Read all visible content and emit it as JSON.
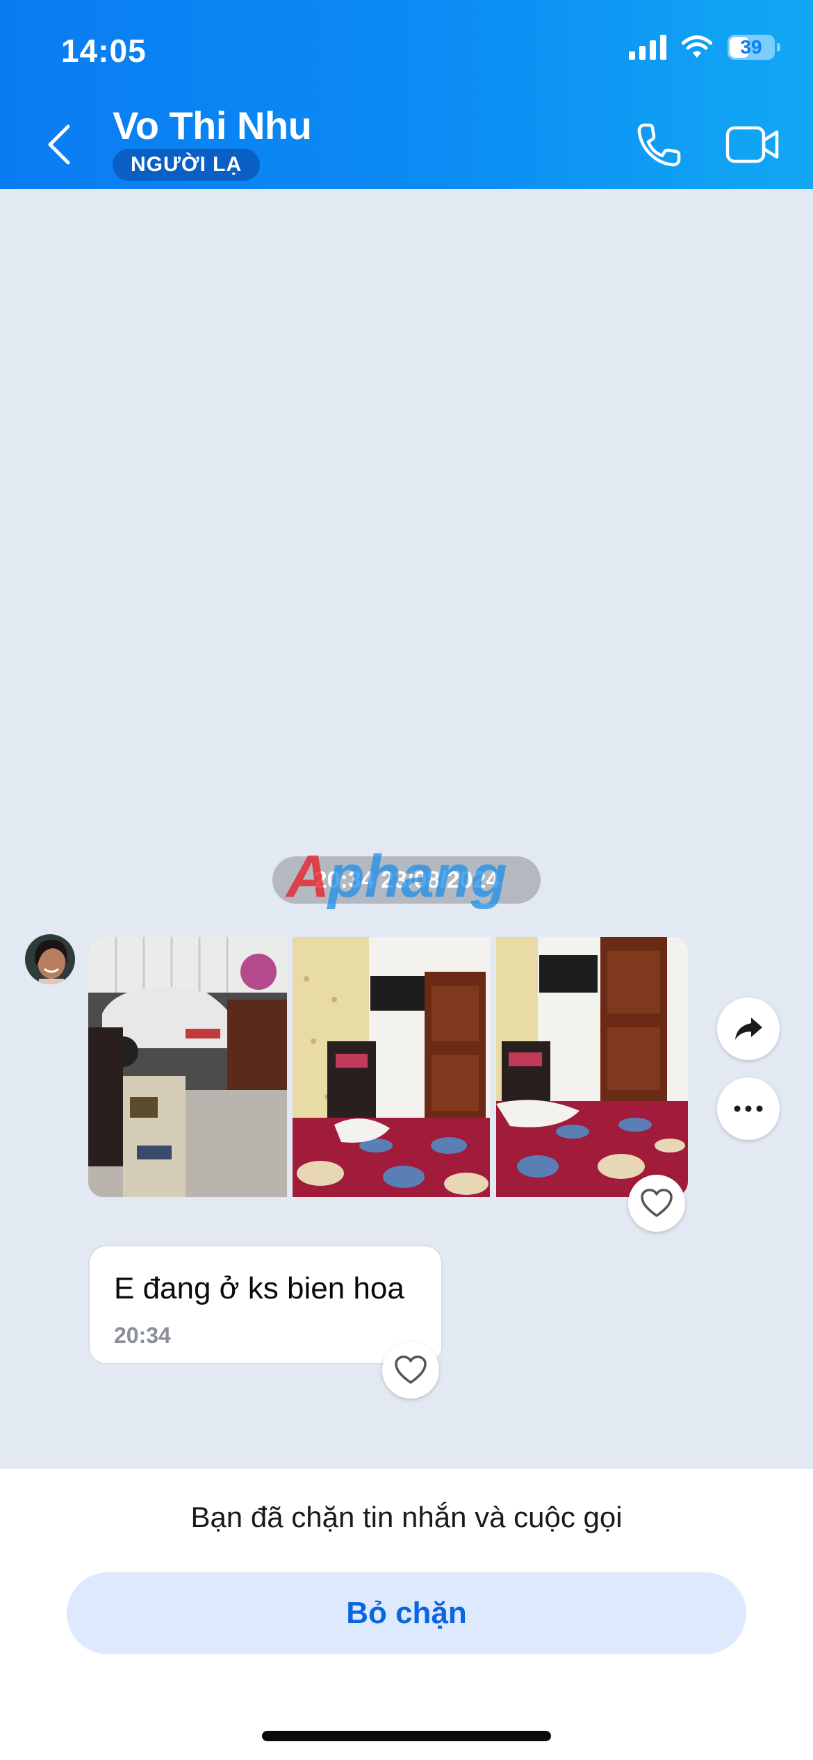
{
  "status_bar": {
    "time": "14:05",
    "battery": "39"
  },
  "header": {
    "title": "Vo Thi Nhu",
    "badge": "NGƯỜI LẠ"
  },
  "chat": {
    "date_separator": "20:34 23/08/2024",
    "watermark_text": "Aphang",
    "message_text": "E đang ở ks bien hoa",
    "message_time": "20:34"
  },
  "footer": {
    "blocked_notice": "Bạn đã chặn tin nhắn và cuộc gọi",
    "unblock_label": "Bỏ chặn"
  },
  "icons": [
    "back-icon",
    "phone-icon",
    "video-call-icon",
    "share-icon",
    "more-icon",
    "heart-icon"
  ],
  "colors": {
    "header": "#0b8cf4",
    "accent": "#0a66e0",
    "background": "#e3e9f2"
  }
}
